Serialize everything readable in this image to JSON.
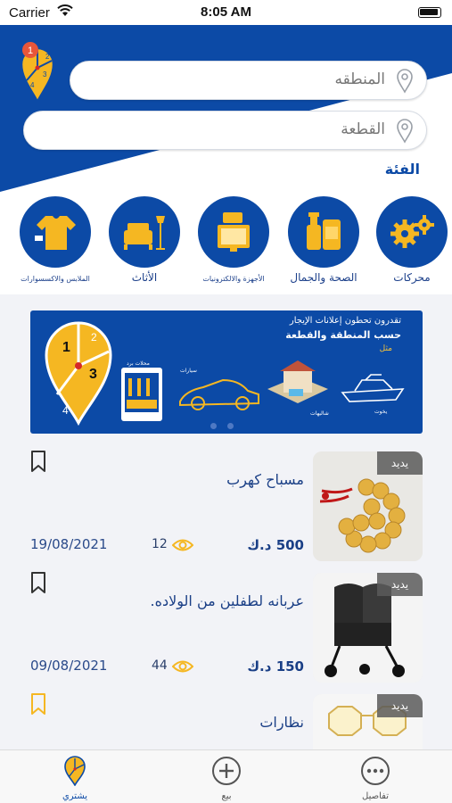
{
  "status_bar": {
    "carrier": "Carrier",
    "time": "8:05 AM"
  },
  "search": {
    "area_placeholder": "المنطقه",
    "block_placeholder": "القطعة"
  },
  "category_title": "الفئة",
  "categories": [
    {
      "label": "محركات",
      "icon": "gears-icon"
    },
    {
      "label": "الصحة والجمال",
      "icon": "beauty-products-icon"
    },
    {
      "label": "الأجهزة والالكترونيات",
      "icon": "electronics-icon"
    },
    {
      "label": "الأثاث",
      "icon": "furniture-icon"
    },
    {
      "label": "الملابس والاكسسوارات",
      "icon": "clothing-icon"
    }
  ],
  "banner": {
    "line1": "تقدرون تحطون إعلانات الإيجار",
    "line2": "حسب المنطقة والقطعة",
    "line3": "مثل",
    "captions": [
      "محلات برد",
      "سيارات",
      "شاليهات",
      "يخوت"
    ]
  },
  "listings": [
    {
      "badge": "يديد",
      "title": "مسباح كهرب",
      "price": "500 د.ك",
      "views": "12",
      "date": "19/08/2021",
      "bookmarked": false
    },
    {
      "badge": "يديد",
      "title": "عربانه لطفلين من الولاده.",
      "price": "150 د.ك",
      "views": "44",
      "date": "09/08/2021",
      "bookmarked": false
    },
    {
      "badge": "يديد",
      "title": "نظارات",
      "bookmarked": true
    }
  ],
  "tabs": [
    {
      "label": "تفاصيل",
      "icon": "more-icon"
    },
    {
      "label": "بيع",
      "icon": "plus-icon"
    },
    {
      "label": "يشتري",
      "icon": "map-pin-logo-icon"
    }
  ],
  "colors": {
    "brand_blue": "#0c4aa6",
    "accent_yellow": "#f5b722"
  }
}
